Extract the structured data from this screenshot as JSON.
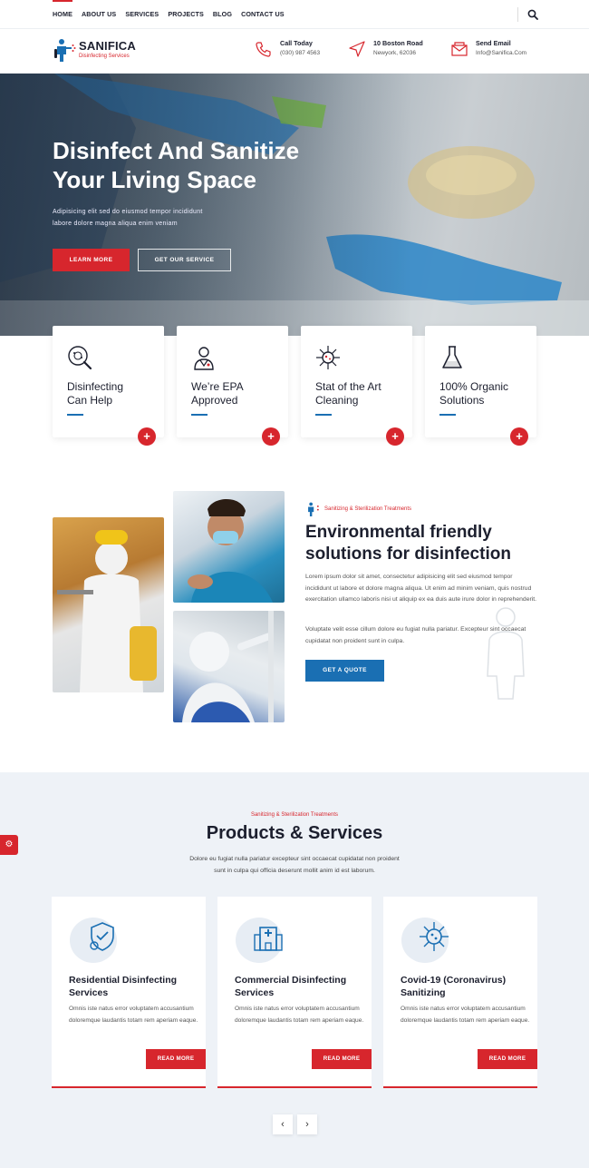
{
  "nav": {
    "items": [
      {
        "label": "HOME",
        "active": true
      },
      {
        "label": "ABOUT US"
      },
      {
        "label": "SERVICES"
      },
      {
        "label": "PROJECTS"
      },
      {
        "label": "BLOG"
      },
      {
        "label": "CONTACT US"
      }
    ]
  },
  "brand": {
    "name": "SANIFICA",
    "tagline": "Disinfecting Services",
    "accent": "#d7262d",
    "primary": "#1a6fb3"
  },
  "contact": {
    "call": {
      "title": "Call Today",
      "value": "(030) 987 4563",
      "icon": "phone-icon"
    },
    "address": {
      "title": "10 Boston Road",
      "value": "Newyork, 62036",
      "icon": "location-arrow-icon"
    },
    "email": {
      "title": "Send Email",
      "value": "Info@Sanifica.Com",
      "icon": "mail-icon"
    }
  },
  "hero": {
    "title_line1": "Disinfect And Sanitize",
    "title_line2": "Your Living Space",
    "subtitle_line1": "Adipisicing elit sed do eiusmod tempor incididunt",
    "subtitle_line2": "labore dolore magna aliqua enim veniam",
    "btn_primary": "LEARN MORE",
    "btn_secondary": "GET OUR SERVICE"
  },
  "features": [
    {
      "line1": "Disinfecting",
      "line2": "Can Help",
      "icon": "virus-magnifier-icon"
    },
    {
      "line1": "We’re EPA",
      "line2": "Approved",
      "icon": "doctor-icon"
    },
    {
      "line1": "Stat of the Art",
      "line2": "Cleaning",
      "icon": "germ-icon"
    },
    {
      "line1": "100% Organic",
      "line2": "Solutions",
      "icon": "flask-icon"
    }
  ],
  "about": {
    "eyebrow": "Sanitizing & Sterilization Treatments",
    "title_line1": "Environmental friendly",
    "title_line2": "solutions for disinfection",
    "para1": "Lorem ipsum dolor sit amet, consectetur adipisicing elit sed eiusmod tempor incididunt ut labore et dolore magna aliqua. Ut enim ad minim veniam, quis nostrud exercitation ullamco laboris nisi ut aliquip ex ea duis aute irure dolor in reprehenderit.",
    "para2": "Voluptate velit esse cillum dolore eu fugiat nulla pariatur. Excepteur sint occaecat cupidatat non proident sunt in culpa.",
    "cta": "GET A QUOTE"
  },
  "products": {
    "eyebrow": "Sanitizing & Sterilization Treatments",
    "title": "Products & Services",
    "desc_line1": "Dolore eu fugiat nulla pariatur excepteur sint occaecat cupidatat non proident",
    "desc_line2": "sunt in culpa qui officia deserunt mollit anim id est laborum.",
    "items": [
      {
        "title_line1": "Residential Disinfecting",
        "title_line2": "Services",
        "desc": "Omnis iste natus error voluptatem accusantium doloremque laudantis totam rem aperiam eaque.",
        "button": "READ MORE",
        "icon": "shield-check-icon"
      },
      {
        "title_line1": "Commercial Disinfecting",
        "title_line2": "Services",
        "desc": "Omnis iste natus error voluptatem accusantium doloremque laudantis totam rem aperiam eaque.",
        "button": "READ MORE",
        "icon": "hospital-icon"
      },
      {
        "title_line1": "Covid-19 (Coronavirus)",
        "title_line2": "Sanitizing",
        "desc": "Omnis iste natus error voluptatem accusantium doloremque laudantis totam rem aperiam eaque.",
        "button": "READ MORE",
        "icon": "coronavirus-icon"
      }
    ],
    "prev": "‹",
    "next": "›"
  }
}
